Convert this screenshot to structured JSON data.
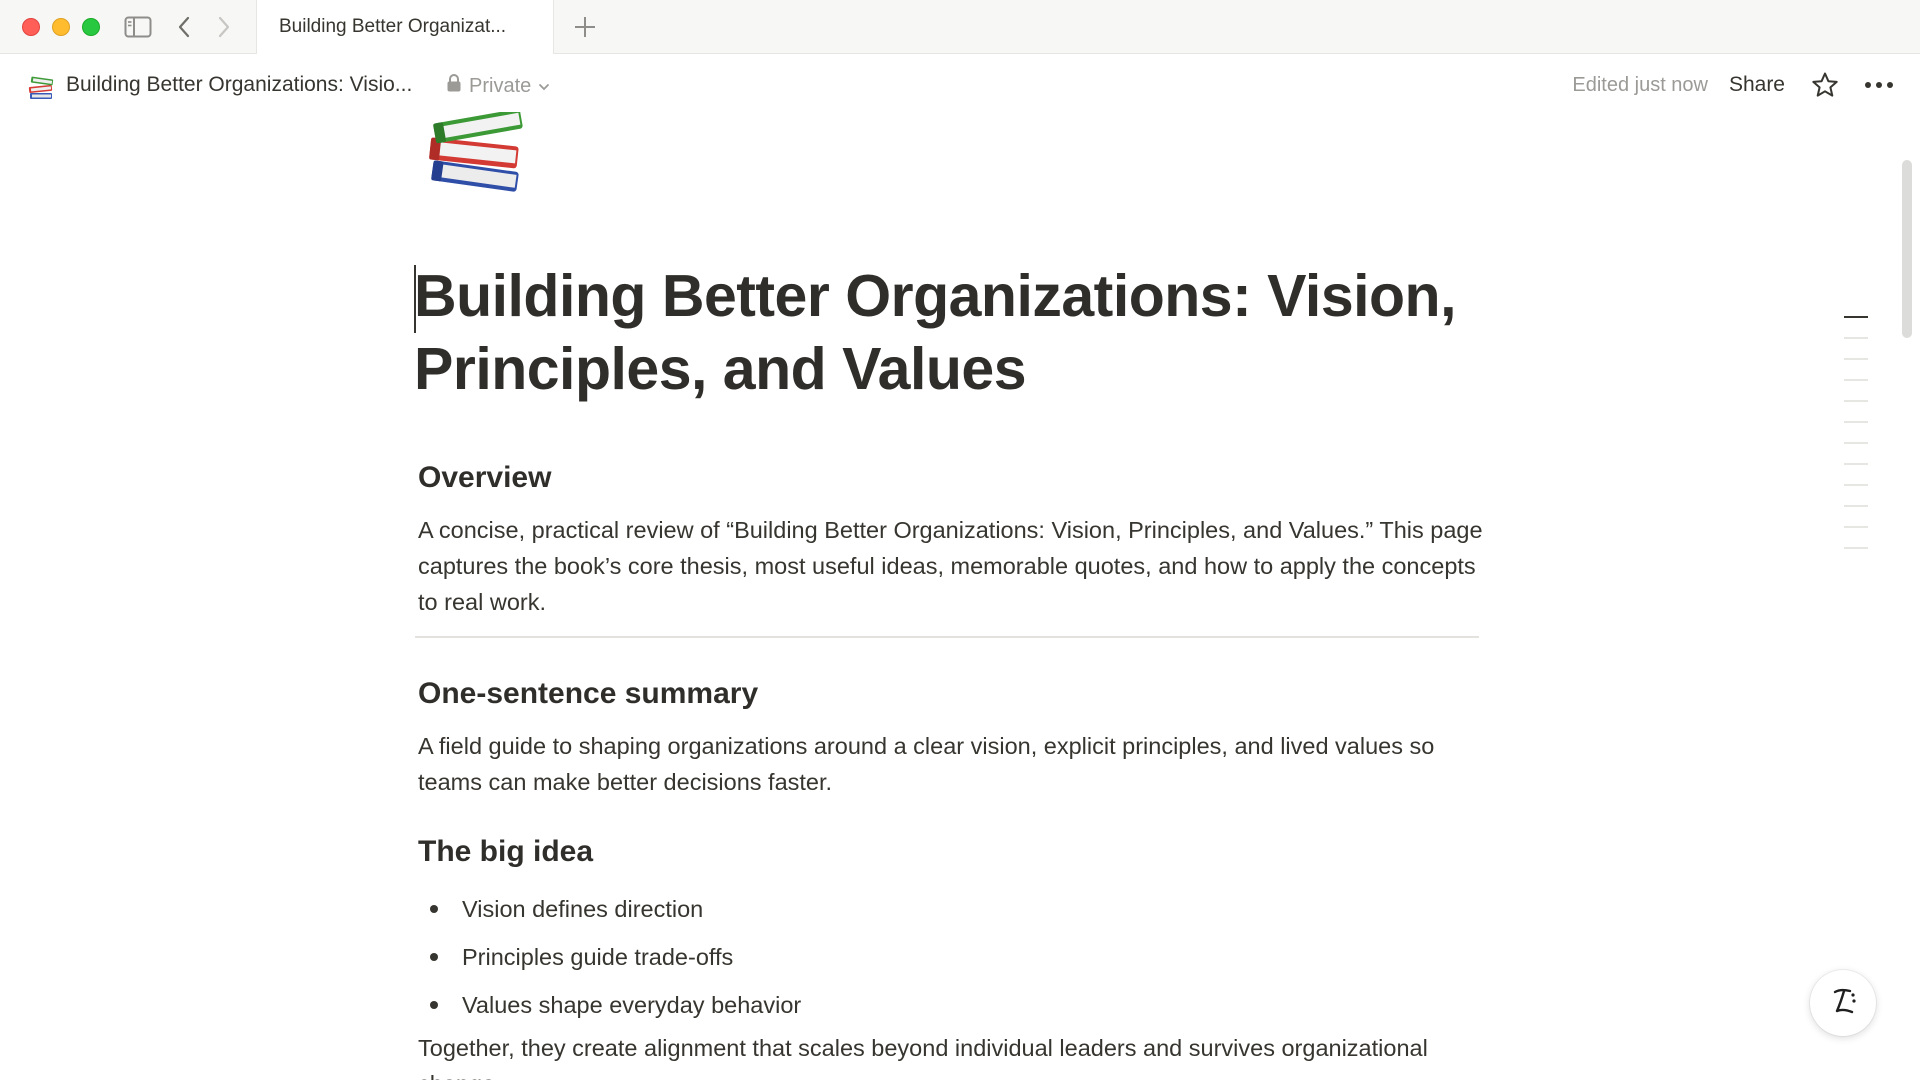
{
  "tabbar": {
    "active_tab_title": "Building Better Organizat..."
  },
  "header": {
    "breadcrumb_title": "Building Better Organizations: Visio...",
    "privacy_label": "Private",
    "edited_status": "Edited just now",
    "share_label": "Share"
  },
  "page": {
    "icon": "books-emoji",
    "title": "Building Better Organizations: Vision, Principles, and Values",
    "sections": {
      "overview": {
        "heading": "Overview",
        "body": "A concise, practical review of “Building Better Organizations: Vision, Principles, and Values.” This page captures the book’s core thesis, most useful ideas, memorable quotes, and how to apply the concepts to real work."
      },
      "summary": {
        "heading": "One-sentence summary",
        "body": "A field guide to shaping organizations around a clear vision, explicit principles, and lived values so teams can make better decisions faster."
      },
      "big_idea": {
        "heading": "The big idea",
        "bullets": [
          "Vision defines direction",
          "Principles guide trade-offs",
          "Values shape everyday behavior"
        ],
        "closing": "Together, they create alignment that scales beyond individual leaders and survives organizational change."
      }
    }
  },
  "icons": {
    "sidebar_toggle": "sidebar-icon",
    "back": "chevron-left-icon",
    "forward": "chevron-right-icon",
    "new_tab": "plus-icon",
    "lock": "lock-icon",
    "chevron": "chevron-down-icon",
    "star": "star-icon",
    "more": "more-horizontal-icon",
    "assistant": "notion-ai-icon"
  },
  "colors": {
    "text": "#37352f",
    "muted": "#9b9a97",
    "chrome_bg": "#f7f7f5"
  }
}
